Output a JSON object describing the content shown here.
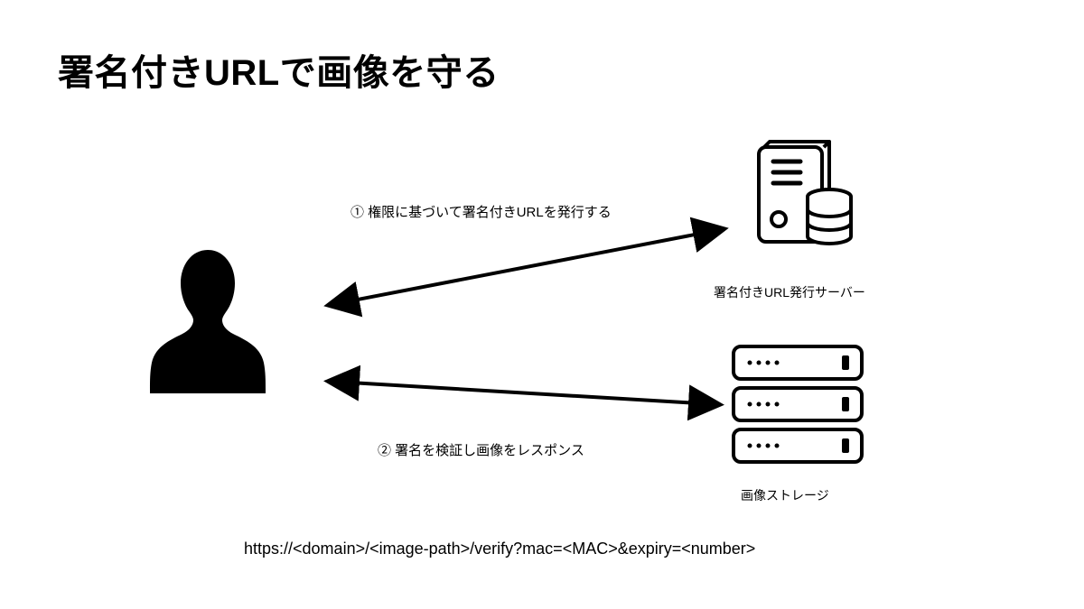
{
  "title": "署名付きURLで画像を守る",
  "server_label": "署名付きURL発行サーバー",
  "storage_label": "画像ストレージ",
  "arrow1_label": "① 権限に基づいて署名付きURLを発行する",
  "arrow2_label": "② 署名を検証し画像をレスポンス",
  "url_pattern": "https://<domain>/<image-path>/verify?mac=<MAC>&expiry=<number>",
  "icons": {
    "person": "user-silhouette",
    "server": "server-with-database",
    "storage": "storage-rack"
  }
}
